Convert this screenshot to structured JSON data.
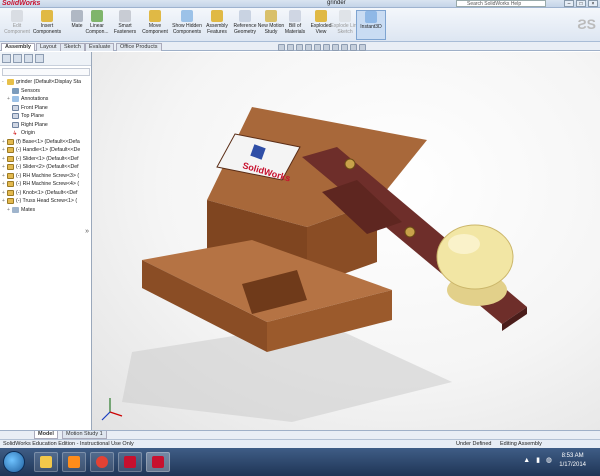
{
  "app": {
    "brand": "SolidWorks",
    "document_title": "grinder",
    "search_placeholder": "Search SolidWorks Help"
  },
  "toolbar": [
    {
      "label": "Edit Component",
      "icon": "edit-component-icon",
      "enabled": false
    },
    {
      "label": "Insert Components",
      "icon": "insert-components-icon",
      "enabled": true
    },
    {
      "label": "Mate",
      "icon": "mate-icon",
      "enabled": true
    },
    {
      "label": "Linear Compon...",
      "icon": "linear-pattern-icon",
      "enabled": true
    },
    {
      "label": "Smart Fasteners",
      "icon": "smart-fasteners-icon",
      "enabled": true
    },
    {
      "label": "Move Component",
      "icon": "move-component-icon",
      "enabled": true
    },
    {
      "label": "Show Hidden Components",
      "icon": "show-hidden-icon",
      "enabled": true
    },
    {
      "label": "Assembly Features",
      "icon": "assembly-features-icon",
      "enabled": true
    },
    {
      "label": "Reference Geometry",
      "icon": "reference-geometry-icon",
      "enabled": true
    },
    {
      "label": "New Motion Study",
      "icon": "motion-study-icon",
      "enabled": true
    },
    {
      "label": "Bill of Materials",
      "icon": "bom-icon",
      "enabled": true
    },
    {
      "label": "Exploded View",
      "icon": "exploded-view-icon",
      "enabled": true
    },
    {
      "label": "Explode Line Sketch",
      "icon": "explode-line-icon",
      "enabled": false
    },
    {
      "label": "Instant3D",
      "icon": "instant3d-icon",
      "enabled": true,
      "active": true
    }
  ],
  "command_tabs": [
    "Assembly",
    "Layout",
    "Sketch",
    "Evaluate",
    "Office Products"
  ],
  "active_command_tab": "Assembly",
  "tree": [
    {
      "label": "grinder  (Default<Display Sta",
      "icon": "assembly-icon",
      "expander": "-"
    },
    {
      "label": "Sensors",
      "icon": "sensors-icon",
      "expander": ""
    },
    {
      "label": "Annotations",
      "icon": "annotations-icon",
      "expander": "+"
    },
    {
      "label": "Front Plane",
      "icon": "plane-icon",
      "expander": ""
    },
    {
      "label": "Top Plane",
      "icon": "plane-icon",
      "expander": ""
    },
    {
      "label": "Right Plane",
      "icon": "plane-icon",
      "expander": ""
    },
    {
      "label": "Origin",
      "icon": "origin-icon",
      "expander": ""
    },
    {
      "label": "(f) Base<1> (Default<<Defa",
      "icon": "part-icon",
      "expander": "+"
    },
    {
      "label": "(-) Handle<1> (Default<<De",
      "icon": "part-icon",
      "expander": "+"
    },
    {
      "label": "(-) Slider<1> (Default<<Def",
      "icon": "part-icon",
      "expander": "+"
    },
    {
      "label": "(-) Slider<2> (Default<<Def",
      "icon": "part-icon",
      "expander": "+"
    },
    {
      "label": "(-) RH Machine Screw<3> (",
      "icon": "part-icon",
      "expander": "+"
    },
    {
      "label": "(-) RH Machine Screw<4> (",
      "icon": "part-icon",
      "expander": "+"
    },
    {
      "label": "(-) Knob<1> (Default<<Def",
      "icon": "part-icon",
      "expander": "+"
    },
    {
      "label": "(-) Truss Head  Screw<1> (",
      "icon": "part-icon",
      "expander": "+"
    },
    {
      "label": "Mates",
      "icon": "mates-icon",
      "expander": "+"
    }
  ],
  "model_tabs": [
    "Model",
    "Motion Study 1"
  ],
  "active_model_tab": "Model",
  "status": {
    "left": "SolidWorks Education Edition - Instructional Use Only",
    "under_defined": "Under Defined",
    "mode": "Editing Assembly"
  },
  "taskbar": {
    "time": "8:53 AM",
    "date": "1/17/2014",
    "apps": [
      "explorer-icon",
      "media-player-icon",
      "chrome-icon",
      "acrobat-icon",
      "solidworks-icon"
    ]
  },
  "viewport": {
    "logo_text": "SolidWorks"
  },
  "colors": {
    "wood": "#9b5a2c",
    "wood_top": "#a8683a",
    "handle": "#6e2e2a",
    "knob": "#f2e6a4",
    "accent": "#c8102e"
  }
}
